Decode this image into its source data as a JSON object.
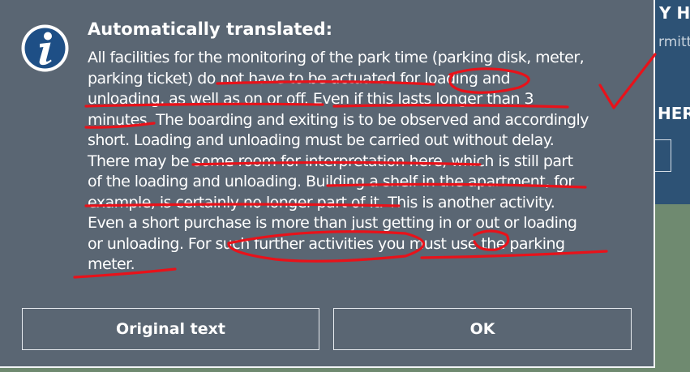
{
  "background": {
    "header_fragment": "Y HI",
    "subtext_fragment": "rmitt",
    "section_fragment": "HER'"
  },
  "dialog": {
    "icon": "info-icon",
    "title": "Automatically translated:",
    "body_lines": [
      "All facilities for the monitoring of the park time (parking disk, meter,",
      "parking ticket) do not have to be actuated for loading and",
      "unloading, as well as on or off. Even if this lasts longer than 3",
      "minutes. The boarding and exiting is to be observed and accordingly",
      "short. Loading and unloading must be carried out without delay.",
      "There may be some room for interpretation here, which is still part",
      "of the loading and unloading. Building a shelf in the apartment, for",
      "example, is certainly no longer part of it. This is another activity.",
      "Even a short purchase is more than just getting in or out or loading",
      "or unloading. For such further activities you must use the parking",
      "meter."
    ],
    "buttons": {
      "original_text": "Original text",
      "ok": "OK"
    }
  },
  "colors": {
    "dialog_bg": "#5a6673",
    "page_bg": "#2d5275",
    "annotation": "#e8121a"
  }
}
